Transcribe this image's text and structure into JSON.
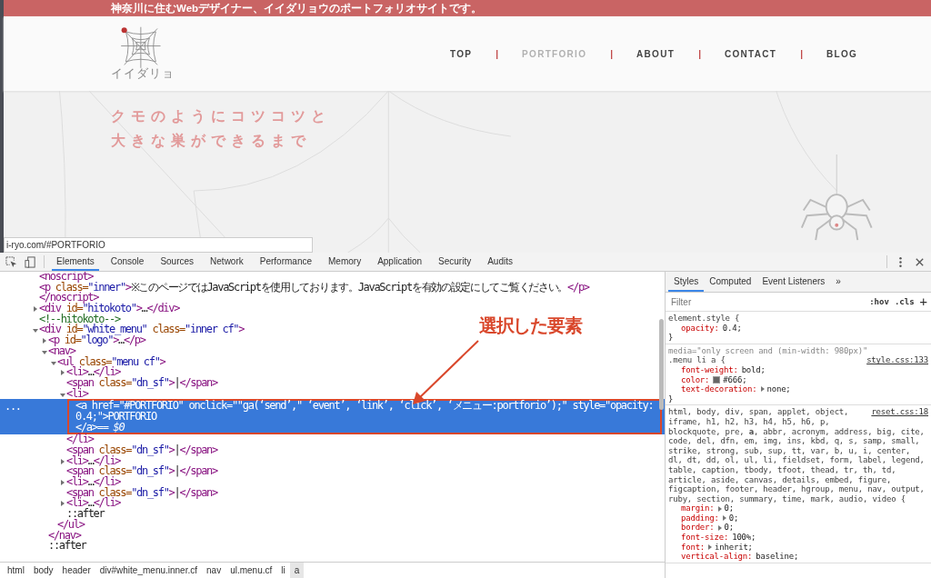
{
  "website": {
    "banner": "神奈川に住むWebデザイナー、イイダリョウのポートフォリオサイトです。",
    "logo_text": "イイダリョ",
    "nav": [
      {
        "kind": "link",
        "label": "TOP",
        "selected": false
      },
      {
        "kind": "separator",
        "label": "|"
      },
      {
        "kind": "link",
        "label": "PORTFORIO",
        "selected": true
      },
      {
        "kind": "separator",
        "label": "|"
      },
      {
        "kind": "link",
        "label": "ABOUT",
        "selected": false
      },
      {
        "kind": "separator",
        "label": "|"
      },
      {
        "kind": "link",
        "label": "CONTACT",
        "selected": false
      },
      {
        "kind": "separator",
        "label": "|"
      },
      {
        "kind": "link",
        "label": "BLOG",
        "selected": false
      }
    ],
    "tagline": [
      "クモのようにコツコツと",
      "大きな巣ができるまで"
    ],
    "status_url": "i-ryo.com/#PORTFORIO"
  },
  "devtools": {
    "tabs": [
      {
        "label": "Elements",
        "selected": true
      },
      {
        "label": "Console",
        "selected": false
      },
      {
        "label": "Sources",
        "selected": false
      },
      {
        "label": "Network",
        "selected": false
      },
      {
        "label": "Performance",
        "selected": false
      },
      {
        "label": "Memory",
        "selected": false
      },
      {
        "label": "Application",
        "selected": false
      },
      {
        "label": "Security",
        "selected": false
      },
      {
        "label": "Audits",
        "selected": false
      }
    ],
    "elements": {
      "gutter_mark": "...",
      "tree": [
        {
          "markup": "<noscript>",
          "selected": false
        },
        {
          "markup": "<p class=\"inner\">※このページではJavaScriptを使用しております。JavaScriptを有効の設定にしてご覧ください。</p>",
          "selected": false
        },
        {
          "markup": "</noscript>",
          "selected": false
        },
        {
          "markup": "<div id=\"hitokoto\">…</div>",
          "expanded": false,
          "selected": false
        },
        {
          "markup": "<!--hitokoto-->",
          "selected": false
        },
        {
          "markup": "<div id=\"white_menu\" class=\"inner cf\">",
          "expanded": true,
          "selected": false,
          "children": [
            {
              "markup": "<p id=\"logo\">…</p>",
              "expanded": false,
              "selected": false
            },
            {
              "markup": "<nav>",
              "expanded": true,
              "selected": false,
              "closing": "</nav>",
              "children": [
                {
                  "markup": "<ul class=\"menu cf\">",
                  "expanded": true,
                  "selected": false,
                  "closing": "</ul>",
                  "children": [
                    {
                      "markup": "<li>…</li>",
                      "expanded": false,
                      "selected": false
                    },
                    {
                      "markup": "<span class=\"dn_sf\">|</span>",
                      "selected": false
                    },
                    {
                      "markup": "<li>",
                      "expanded": true,
                      "selected": false,
                      "closing": "</li>",
                      "children": [
                        {
                          "markup": "<a href=\"#PORTFORIO\" onclick=\"\"ga(‘send’,\" ‘event’, ‘link’, ‘click’, ‘メニュー:portforio’);\" style=\"opacity: 0.4;\">PORTFORIO",
                          "selected": true,
                          "closing": "</a>",
                          "console_ref": "== $0"
                        }
                      ]
                    },
                    {
                      "markup": "<span class=\"dn_sf\">|</span>",
                      "selected": false
                    },
                    {
                      "markup": "<li>…</li>",
                      "expanded": false,
                      "selected": false
                    },
                    {
                      "markup": "<span class=\"dn_sf\">|</span>",
                      "selected": false
                    },
                    {
                      "markup": "<li>…</li>",
                      "expanded": false,
                      "selected": false
                    },
                    {
                      "markup": "<span class=\"dn_sf\">|</span>",
                      "selected": false
                    },
                    {
                      "markup": "<li>…</li>",
                      "expanded": false,
                      "selected": false
                    },
                    {
                      "markup": "::after",
                      "selected": false
                    }
                  ]
                }
              ]
            },
            {
              "markup": "::after",
              "selected": false
            }
          ]
        }
      ],
      "breadcrumbs": [
        {
          "label": "html",
          "selected": false
        },
        {
          "label": "body",
          "selected": false
        },
        {
          "label": "header",
          "selected": false
        },
        {
          "label": "div#white_menu.inner.cf",
          "selected": false
        },
        {
          "label": "nav",
          "selected": false
        },
        {
          "label": "ul.menu.cf",
          "selected": false
        },
        {
          "label": "li",
          "selected": false
        },
        {
          "label": "a",
          "selected": true
        }
      ]
    },
    "annotation": {
      "label": "選択した要素"
    },
    "styles": {
      "tabs": [
        {
          "label": "Styles",
          "selected": true
        },
        {
          "label": "Computed",
          "selected": false
        },
        {
          "label": "Event Listeners",
          "selected": false
        }
      ],
      "more_tabs": "»",
      "filter": {
        "placeholder": "Filter"
      },
      "hov": ":hov",
      "cls": ".cls",
      "add": "+",
      "rules": [
        {
          "selector": [
            "element.style {"
          ],
          "closing": "}",
          "declarations": [
            {
              "property": "opacity:",
              "value": "0.4;"
            }
          ]
        },
        {
          "media": "media=\"only screen and (min-width: 980px)\"",
          "selector": [
            ".menu li a {"
          ],
          "source": "style.css:133",
          "closing": "}",
          "declarations": [
            {
              "property": "font-weight:",
              "value": "bold;"
            },
            {
              "property": "color:",
              "value": "#666;",
              "swatch": true
            },
            {
              "property": "text-decoration:",
              "value": "none;",
              "expandable": true
            }
          ]
        },
        {
          "selector": [
            "html, body, div, span, applet, object,",
            "iframe, h1, h2, h3, h4, h5, h6, p,",
            "blockquote, pre, **a**, abbr, acronym, address, big, cite,",
            "code, del, dfn, em, img, ins, kbd, q, s, samp, small,",
            "strike, strong, sub, sup, tt, var, b, u, i, center,",
            "dl, dt, dd, ol, ul, li, fieldset, form, label, legend,",
            "table, caption, tbody, tfoot, thead, tr, th, td,",
            "article, aside, canvas, details, embed, figure,",
            "figcaption, footer, header, hgroup, menu, nav, output,",
            "ruby, section, summary, time, mark, audio, video {"
          ],
          "source": "reset.css:18",
          "declarations": [
            {
              "property": "margin:",
              "value": "0;",
              "expandable": true
            },
            {
              "property": "padding:",
              "value": "0;",
              "expandable": true
            },
            {
              "property": "border:",
              "value": "0;",
              "expandable": true
            },
            {
              "property": "font-size:",
              "value": "100%;"
            },
            {
              "property": "font:",
              "value": "inherit;",
              "expandable": true
            },
            {
              "property": "vertical-align:",
              "value": "baseline;"
            }
          ]
        }
      ]
    }
  }
}
